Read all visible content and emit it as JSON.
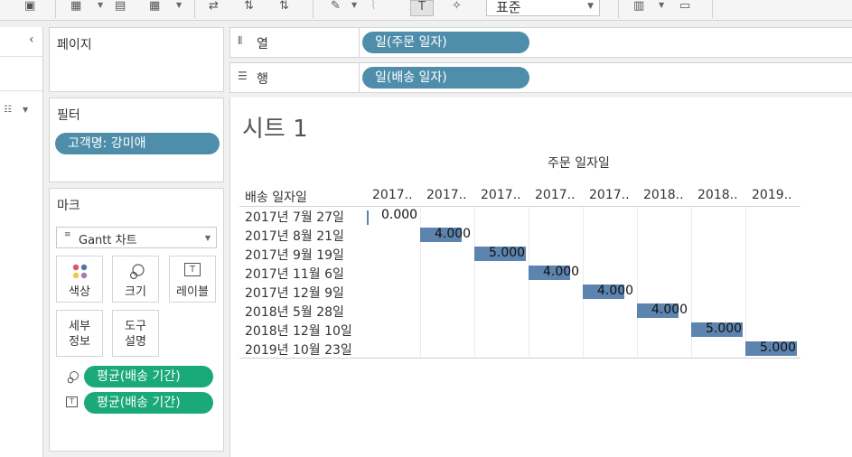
{
  "toolbar": {
    "std_select": "표준",
    "icons": [
      "new-datasource-icon",
      "new-sheet-icon",
      "duplicate-icon",
      "clear-icon",
      "swap-icon",
      "sort-asc-icon",
      "sort-desc-icon",
      "highlight-icon",
      "paperclip-icon",
      "label-toggle-icon",
      "pin-icon",
      "show-me-icon",
      "presentation-icon"
    ]
  },
  "cards": {
    "pages": {
      "title": "페이지"
    },
    "filters": {
      "title": "필터",
      "pill": "고객명: 강미애"
    },
    "marks": {
      "title": "마크",
      "mark_type": "Gantt 차트",
      "buttons": [
        {
          "label": "색상"
        },
        {
          "label": "크기"
        },
        {
          "label": "레이블"
        },
        {
          "label": "세부\n정보"
        },
        {
          "label": "도구\n설명"
        }
      ],
      "fields": [
        "평균(배송 기간)",
        "평균(배송 기간)"
      ]
    }
  },
  "shelves": {
    "columns": {
      "label": "열",
      "pill": "일(주문 일자)"
    },
    "rows": {
      "label": "행",
      "pill": "일(배송 일자)"
    }
  },
  "view": {
    "title": "시트 1",
    "col_header_title": "주문 일자일",
    "row_header_title": "배송 일자일",
    "column_headers": [
      "2017..",
      "2017..",
      "2017..",
      "2017..",
      "2017..",
      "2018..",
      "2018..",
      "2019.."
    ],
    "rows": [
      {
        "label": "2017년 7월 27일",
        "col": 0,
        "value": "0.000"
      },
      {
        "label": "2017년 8월 21일",
        "col": 1,
        "value": "4.000"
      },
      {
        "label": "2017년 9월 19일",
        "col": 2,
        "value": "5.000"
      },
      {
        "label": "2017년 11월 6일",
        "col": 3,
        "value": "4.000"
      },
      {
        "label": "2017년 12월 9일",
        "col": 4,
        "value": "4.000"
      },
      {
        "label": "2018년 5월 28일",
        "col": 5,
        "value": "4.000"
      },
      {
        "label": "2018년 12월 10일",
        "col": 6,
        "value": "5.000"
      },
      {
        "label": "2019년 10월 23일",
        "col": 7,
        "value": "5.000"
      }
    ]
  },
  "colors": {
    "pill_blue": "#4e8eaa",
    "pill_green": "#1aa978",
    "bar": "#4e79a7"
  }
}
